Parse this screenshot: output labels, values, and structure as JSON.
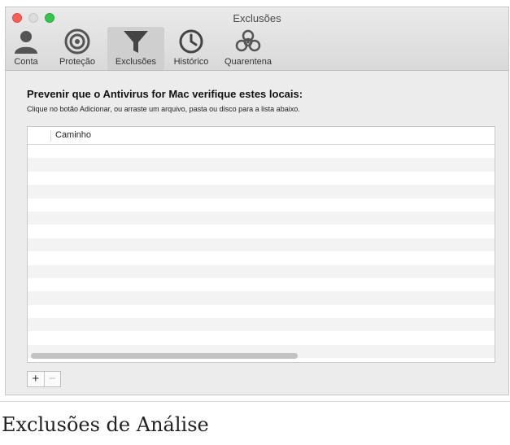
{
  "window": {
    "title": "Exclusões",
    "tabs": [
      {
        "label": "Conta",
        "icon": "person-icon"
      },
      {
        "label": "Proteção",
        "icon": "shield-icon"
      },
      {
        "label": "Exclusões",
        "icon": "funnel-icon",
        "selected": true
      },
      {
        "label": "Histórico",
        "icon": "clock-icon"
      },
      {
        "label": "Quarentena",
        "icon": "biohazard-icon"
      }
    ]
  },
  "content": {
    "heading": "Prevenir que o Antivirus for Mac verifique estes locais:",
    "subtext": "Clique no botão Adicionar, ou arraste um arquivo, pasta ou disco para a lista abaixo.",
    "table": {
      "columns": [
        "Caminho"
      ],
      "rows": []
    },
    "buttons": {
      "add": "+",
      "remove": "−"
    }
  },
  "caption": "Exclusões de Análise",
  "colors": {
    "close": "#fc5f57",
    "minimize": "#dcdcdc",
    "zoom": "#34c749",
    "selected_tab": "#cfcfcf"
  }
}
